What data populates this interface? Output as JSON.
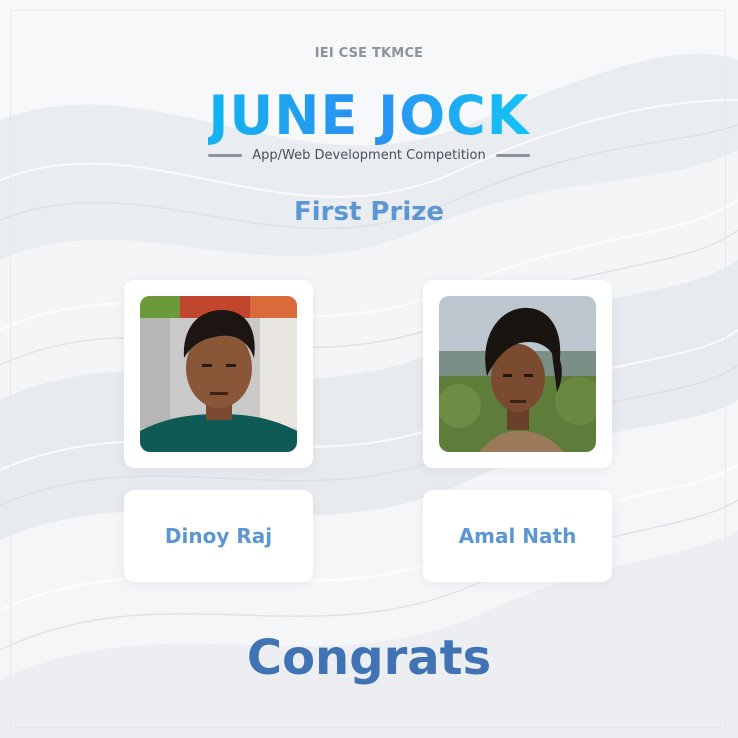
{
  "header": {
    "organization": "IEI CSE TKMCE",
    "title": "JUNE JOCK",
    "subtitle": "App/Web Development Competition"
  },
  "award": {
    "label": "First Prize"
  },
  "winners": [
    {
      "name": "Dinoy Raj",
      "photo_icon": "person-photo"
    },
    {
      "name": "Amal Nath",
      "photo_icon": "person-photo"
    }
  ],
  "footer": {
    "message": "Congrats"
  },
  "colors": {
    "background": "#eef0f3",
    "title_gradient_start": "#12b4f0",
    "title_gradient_end": "#2c8ff0",
    "accent_blue": "#5d97d3",
    "congrats_blue": "#3f73b4",
    "muted_gray": "#8d939b"
  }
}
